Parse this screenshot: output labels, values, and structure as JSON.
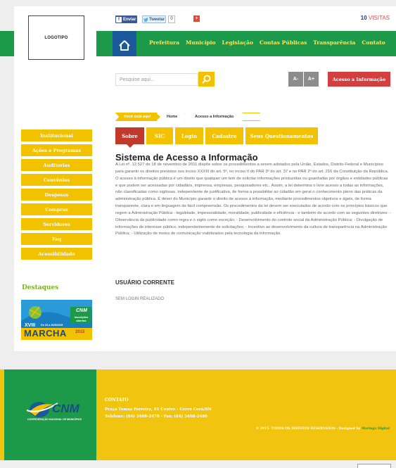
{
  "header": {
    "logo": "LOGOTIPO",
    "share": {
      "facebook": "Enviar",
      "twitter": "Tweetar",
      "tweet_count": "0",
      "gplus": "+"
    },
    "visits": {
      "count": "10",
      "label": "VISITAS"
    },
    "nav": [
      "Prefeitura",
      "Município",
      "Legislação",
      "Contas Públicas",
      "Transparência",
      "Contato"
    ]
  },
  "toolbar": {
    "search_placeholder": "Pesquise aqui...",
    "font_decrease": "A-",
    "font_increase": "A+",
    "access_button": "Acesso a Informação"
  },
  "breadcrumb": {
    "here": "Você está aqui",
    "home": "Home",
    "current": "Acesso a Informação"
  },
  "tabs": [
    {
      "label": "Sobre",
      "active": true
    },
    {
      "label": "SIC",
      "active": false
    },
    {
      "label": "Login",
      "active": false
    },
    {
      "label": "Cadastro",
      "active": false
    },
    {
      "label": "Seus Questionamentos",
      "active": false
    }
  ],
  "content": {
    "title": "Sistema de Acesso a Informação",
    "body": "A Lei nº. 12.527 de 18 de novembro de 2011 dispõe sobre os procedimentos a serem adotados pela União, Estados, Distrito Federal e Municípios para garantir os direitos previstos nos inciso XXXIII do art. 5º, no inciso II do  PAR 3º do art. 37 e no  PAR 2º do art. 216 da Constituição da República. O acesso à informação pública é um direito que qualquer um tem de solicitar informações produzidas ou guardadas por órgãos e entidades públicas e que podem ser acessadas por cidadãos, imprensa, empresas, pesquisadores etc.. Assim, a lei determina o livre acesso a todas as informações, não classificadas como sigilosas, independente de justificativa, de forma a possibilitar ao cidadão em geral o conhecimento pleno das práticas da administração pública. É dever do Município garantir o direito de acesso à informação, mediante procedimentos objetivos e ágeis, de forma transparente, clara e em linguagem de fácil compreensão. Os procedimentos da lei devem ser executados de acordo com os princípios básicos que regem a Administração Pública - legalidade, impessoalidade, moralidade, publicidade e eficiência - e também de acordo com as seguintes diretrizes: - Observância da publicidade como regra e o sigilo como exceção; - Desenvolvimento do controle social da Administração Pública; - Divulgação de informações de interesse público, independentemente de solicitações; - Incentivo ao desenvolvimento da cultura de transparência na Administração Pública; - Utilização de meios de comunicação viabilizados pela tecnologia da informação.",
    "user_title": "USUÁRIO CORRENTE",
    "user_status": "SEM LOGIN REALIZADO"
  },
  "sidebar": {
    "items": [
      "Institucional",
      "Ações e Programas",
      "Auditorias",
      "Convênios",
      "Despesas",
      "Compras",
      "Servidores",
      "Faq",
      "Acessibilidade"
    ],
    "highlights_title": "Destaques",
    "banner": {
      "line1": "XVIII",
      "line2": "MARCHA",
      "dates": "De 23 a 26/5/2015",
      "badge": "Inscrições abertas",
      "brand": "CNM",
      "year": "2015"
    }
  },
  "footer": {
    "logo_text": "CNM",
    "logo_sub": "CONFEDERAÇÃO NACIONAL DE MUNICÍPIOS",
    "contact_title": "CONTATO",
    "address": "Praça Tomaz Ferreira, 01 Centro - Cerro Corá/RN",
    "phone": "Telefone: (84) 3488-2478 - Fax: (84) 3488-2480",
    "copyright": "© 2015. TODOS OS DIREITOS RESERVADOS - Designed by",
    "designer": "Maringa Digital"
  },
  "colors": {
    "green": "#1c9a4a",
    "yellow": "#f2c100",
    "red": "#d43e3e",
    "blue": "#1b5a9a"
  }
}
